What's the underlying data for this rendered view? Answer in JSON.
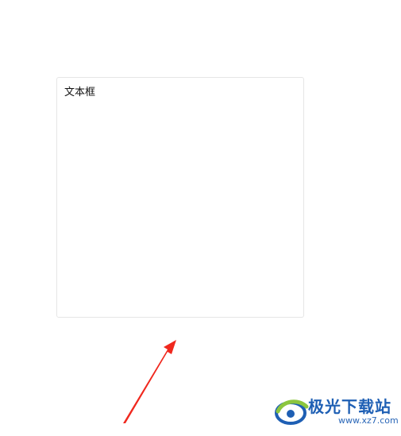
{
  "textbox": {
    "label": "文本框"
  },
  "watermark": {
    "name": "极光下载站",
    "url": "www.xz7.com"
  },
  "colors": {
    "arrow": "#f0281e",
    "textbox_border": "#e6e6e6",
    "watermark_blue": "#1e5fb4",
    "watermark_green": "#8cc63e"
  },
  "icons": {
    "annotation": "red-arrow-icon",
    "logo": "aurora-logo-icon"
  }
}
